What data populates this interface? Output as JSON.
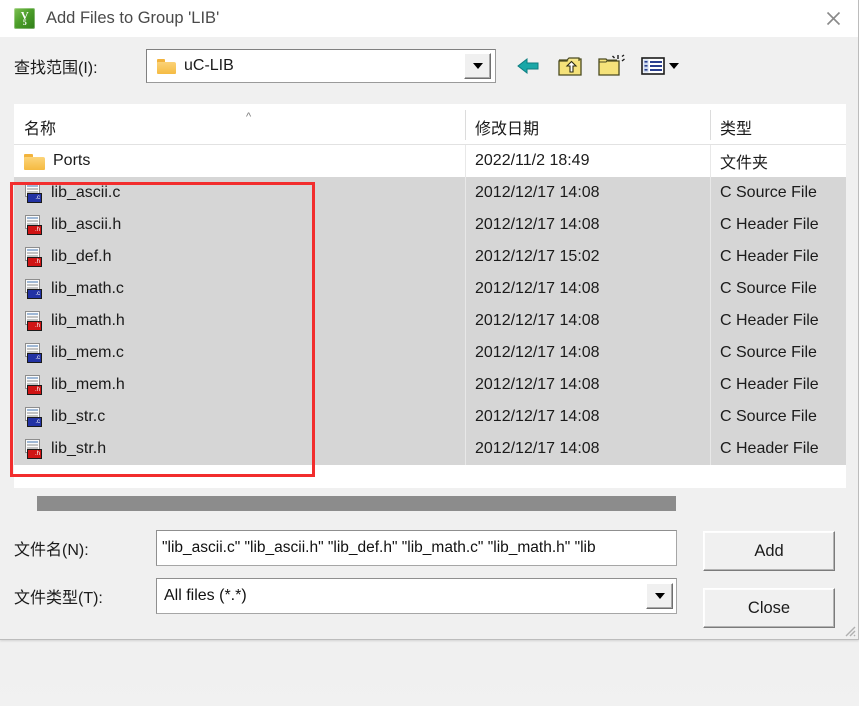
{
  "window": {
    "title": "Add Files to Group 'LIB'",
    "app_icon": "uvision-icon",
    "app_icon_text_top": "V",
    "app_icon_text_sub": "5",
    "close_icon": "close-icon"
  },
  "lookin": {
    "label_prefix": "查找范围(",
    "label_key": "I",
    "label_suffix": "):",
    "label_full": "查找范围(I):",
    "selected_folder": "uC-LIB",
    "folder_icon": "folder-icon",
    "dropdown_icon": "chevron-down-icon"
  },
  "toolbar": {
    "items": [
      {
        "name": "back-button",
        "icon": "back-arrow-icon",
        "label": "Back"
      },
      {
        "name": "up-one-level-button",
        "icon": "up-folder-icon",
        "label": "Up One Level"
      },
      {
        "name": "create-new-folder-button",
        "icon": "new-folder-icon",
        "label": "Create New Folder"
      },
      {
        "name": "views-button",
        "icon": "views-list-icon",
        "label": "Views"
      }
    ]
  },
  "file_list": {
    "columns": [
      {
        "key": "name",
        "label": "名称",
        "sort_indicator": "^"
      },
      {
        "key": "date",
        "label": "修改日期"
      },
      {
        "key": "type",
        "label": "类型"
      }
    ],
    "rows": [
      {
        "name": "Ports",
        "date": "2022/11/2 18:49",
        "type": "文件夹",
        "icon": "folder-icon",
        "selected": false
      },
      {
        "name": "lib_ascii.c",
        "date": "2012/12/17 14:08",
        "type": "C Source File",
        "icon": "c-source-icon",
        "badge": ".c",
        "selected": true
      },
      {
        "name": "lib_ascii.h",
        "date": "2012/12/17 14:08",
        "type": "C Header File",
        "icon": "c-header-icon",
        "badge": ".h",
        "selected": true
      },
      {
        "name": "lib_def.h",
        "date": "2012/12/17 15:02",
        "type": "C Header File",
        "icon": "c-header-icon",
        "badge": ".h",
        "selected": true
      },
      {
        "name": "lib_math.c",
        "date": "2012/12/17 14:08",
        "type": "C Source File",
        "icon": "c-source-icon",
        "badge": ".c",
        "selected": true
      },
      {
        "name": "lib_math.h",
        "date": "2012/12/17 14:08",
        "type": "C Header File",
        "icon": "c-header-icon",
        "badge": ".h",
        "selected": true
      },
      {
        "name": "lib_mem.c",
        "date": "2012/12/17 14:08",
        "type": "C Source File",
        "icon": "c-source-icon",
        "badge": ".c",
        "selected": true
      },
      {
        "name": "lib_mem.h",
        "date": "2012/12/17 14:08",
        "type": "C Header File",
        "icon": "c-header-icon",
        "badge": ".h",
        "selected": true
      },
      {
        "name": "lib_str.c",
        "date": "2012/12/17 14:08",
        "type": "C Source File",
        "icon": "c-source-icon",
        "badge": ".c",
        "selected": true
      },
      {
        "name": "lib_str.h",
        "date": "2012/12/17 14:08",
        "type": "C Header File",
        "icon": "c-header-icon",
        "badge": ".h",
        "selected": true
      }
    ]
  },
  "annotation": {
    "highlight_color": "#f22d2d",
    "kind": "selection-rectangle"
  },
  "scrollbar": {
    "orientation": "horizontal",
    "name": "horizontal-scrollbar"
  },
  "filename_field": {
    "label": "文件名(N):",
    "value": "\"lib_ascii.c\" \"lib_ascii.h\" \"lib_def.h\" \"lib_math.c\" \"lib_math.h\" \"lib",
    "placeholder": ""
  },
  "filetype_field": {
    "label": "文件类型(T):",
    "value": "All files (*.*)",
    "dropdown_icon": "chevron-down-icon"
  },
  "buttons": {
    "add": "Add",
    "close": "Close"
  }
}
